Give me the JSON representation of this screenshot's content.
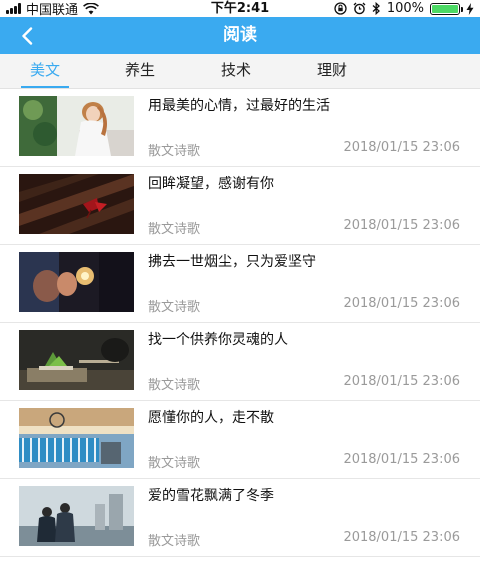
{
  "status_bar": {
    "carrier": "中国联通",
    "time": "下午2:41",
    "battery": "100%",
    "battery_level": 1.0,
    "icons": [
      "signal-icon",
      "wifi-icon",
      "lock-rotation-icon",
      "alarm-icon",
      "bluetooth-icon",
      "battery-icon",
      "charging-icon"
    ]
  },
  "nav": {
    "title": "阅读",
    "back_icon": "chevron-left-icon"
  },
  "tabs": [
    {
      "label": "美文",
      "active": true
    },
    {
      "label": "养生",
      "active": false
    },
    {
      "label": "技术",
      "active": false
    },
    {
      "label": "理财",
      "active": false
    }
  ],
  "articles": [
    {
      "title": "用最美的心情，过最好的生活",
      "category": "散文诗歌",
      "date": "2018/01/15 23:06"
    },
    {
      "title": "回眸凝望，感谢有你",
      "category": "散文诗歌",
      "date": "2018/01/15 23:06"
    },
    {
      "title": "拂去一世烟尘，只为爱坚守",
      "category": "散文诗歌",
      "date": "2018/01/15 23:06"
    },
    {
      "title": "找一个供养你灵魂的人",
      "category": "散文诗歌",
      "date": "2018/01/15 23:06"
    },
    {
      "title": "愿懂你的人，走不散",
      "category": "散文诗歌",
      "date": "2018/01/15 23:06"
    },
    {
      "title": "爱的雪花飘满了冬季",
      "category": "散文诗歌",
      "date": "2018/01/15 23:06"
    }
  ],
  "colors": {
    "accent": "#3aaaf0",
    "nav_bg": "#3aaaf0",
    "tab_bg": "#f4f4f4",
    "meta_text": "#9a9a9a"
  }
}
